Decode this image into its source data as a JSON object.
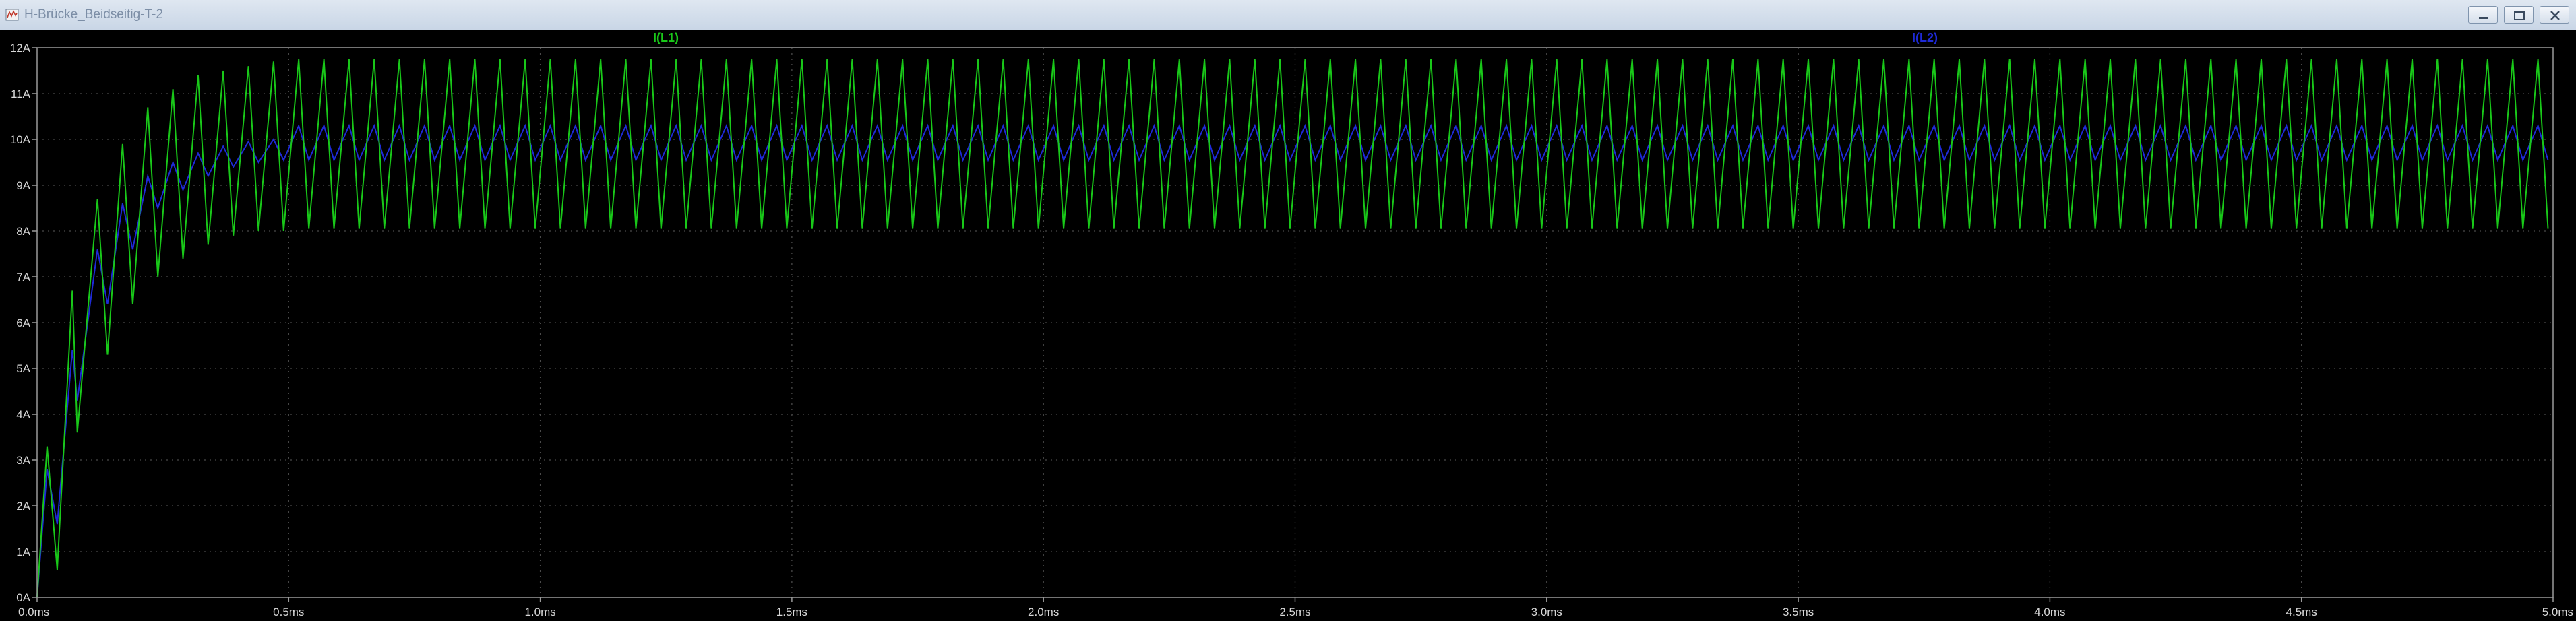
{
  "window": {
    "title": "H-Brücke_Beidseitig-T-2",
    "controls": {
      "minimize": "minimize-icon",
      "restore": "restore-icon",
      "close": "close-icon"
    }
  },
  "colors": {
    "background": "#000000",
    "axis": "#9a9a9a",
    "grid": "#4a4a4a",
    "tick_text": "#d8d8d8",
    "trace_l1": "#19c819",
    "trace_l2": "#1e2ad8"
  },
  "chart_data": {
    "type": "line",
    "title": "",
    "xlabel": "",
    "ylabel": "",
    "xlim": [
      0,
      5.0
    ],
    "ylim": [
      0,
      12
    ],
    "grid": true,
    "x_ticks": [
      "0.0ms",
      "0.5ms",
      "1.0ms",
      "1.5ms",
      "2.0ms",
      "2.5ms",
      "3.0ms",
      "3.5ms",
      "4.0ms",
      "4.5ms",
      "5.0ms"
    ],
    "y_ticks": [
      "0A",
      "1A",
      "2A",
      "3A",
      "4A",
      "5A",
      "6A",
      "7A",
      "8A",
      "9A",
      "10A",
      "11A",
      "12A"
    ],
    "series": [
      {
        "name": "I(L1)",
        "color": "#19c819",
        "x_unit": "ms",
        "y_unit": "A",
        "points": [
          [
            0.0,
            0.0
          ],
          [
            0.02,
            3.3
          ],
          [
            0.04,
            0.6
          ],
          [
            0.07,
            6.7
          ],
          [
            0.08,
            3.6
          ],
          [
            0.12,
            8.7
          ],
          [
            0.14,
            5.3
          ],
          [
            0.17,
            9.9
          ],
          [
            0.19,
            6.4
          ],
          [
            0.22,
            10.7
          ],
          [
            0.24,
            7.0
          ],
          [
            0.27,
            11.1
          ],
          [
            0.29,
            7.4
          ],
          [
            0.32,
            11.4
          ],
          [
            0.34,
            7.7
          ],
          [
            0.37,
            11.5
          ],
          [
            0.39,
            7.9
          ],
          [
            0.42,
            11.6
          ],
          [
            0.44,
            8.0
          ],
          [
            0.47,
            11.7
          ],
          [
            0.49,
            8.0
          ],
          [
            0.52,
            11.75
          ],
          [
            0.54,
            8.05
          ]
        ],
        "steady_state": {
          "from_ms": 0.54,
          "to_ms": 5.0,
          "min": 8.05,
          "max": 11.75,
          "period_ms": 0.05
        }
      },
      {
        "name": "I(L2)",
        "color": "#1e2ad8",
        "x_unit": "ms",
        "y_unit": "A",
        "points": [
          [
            0.0,
            0.0
          ],
          [
            0.02,
            2.8
          ],
          [
            0.04,
            1.6
          ],
          [
            0.07,
            5.4
          ],
          [
            0.08,
            4.3
          ],
          [
            0.12,
            7.6
          ],
          [
            0.14,
            6.4
          ],
          [
            0.17,
            8.6
          ],
          [
            0.19,
            7.6
          ],
          [
            0.22,
            9.2
          ],
          [
            0.24,
            8.5
          ],
          [
            0.27,
            9.5
          ],
          [
            0.29,
            8.9
          ],
          [
            0.32,
            9.7
          ],
          [
            0.34,
            9.2
          ],
          [
            0.37,
            9.85
          ],
          [
            0.39,
            9.4
          ],
          [
            0.42,
            9.95
          ],
          [
            0.44,
            9.5
          ],
          [
            0.47,
            10.0
          ],
          [
            0.49,
            9.55
          ]
        ],
        "steady_state": {
          "from_ms": 0.49,
          "to_ms": 5.0,
          "min": 9.55,
          "max": 10.3,
          "period_ms": 0.05
        }
      }
    ]
  }
}
